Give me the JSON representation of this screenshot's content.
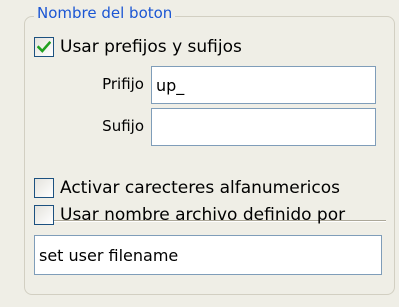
{
  "group": {
    "title": "Nombre del boton"
  },
  "prefix_suffix_option": {
    "label": "Usar prefijos y sufijos",
    "checked": true
  },
  "prefix_field": {
    "label": "Prifijo",
    "value": "up_"
  },
  "suffix_field": {
    "label": "Sufijo",
    "value": ""
  },
  "alphanumeric_option": {
    "label": "Activar carecteres alfanumericos",
    "checked": false
  },
  "filename_option": {
    "label": "Usar nombre archivo definido por",
    "checked": false
  },
  "filename_field": {
    "value": "set user filename"
  },
  "colors": {
    "legend_text": "#1b56d4",
    "checkmark": "#21a121",
    "checkbox_border": "#1c5180",
    "input_border": "#7f9db9",
    "panel_background": "#efeee6"
  },
  "icons": {
    "checkmark": "checkmark-icon"
  }
}
